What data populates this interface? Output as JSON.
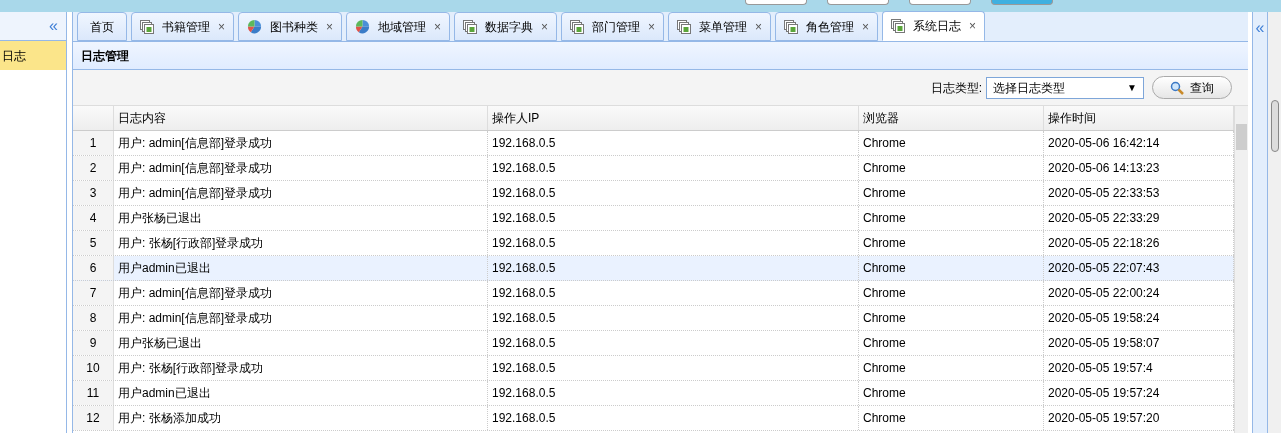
{
  "sidebar": {
    "items": [
      {
        "label": "日志",
        "selected": true
      }
    ]
  },
  "tabs": [
    {
      "label": "首页",
      "kind": "home",
      "selected": false
    },
    {
      "label": "书籍管理",
      "kind": "pages",
      "selected": false
    },
    {
      "label": "图书种类",
      "kind": "pie",
      "selected": false
    },
    {
      "label": "地域管理",
      "kind": "pie",
      "selected": false
    },
    {
      "label": "数据字典",
      "kind": "pages",
      "selected": false
    },
    {
      "label": "部门管理",
      "kind": "pages",
      "selected": false
    },
    {
      "label": "菜单管理",
      "kind": "pages",
      "selected": false
    },
    {
      "label": "角色管理",
      "kind": "pages",
      "selected": false
    },
    {
      "label": "系统日志",
      "kind": "pages",
      "selected": true
    }
  ],
  "close_glyph": "×",
  "collapse_glyph": "«",
  "panel": {
    "title": "日志管理"
  },
  "filter": {
    "label": "日志类型:",
    "value": "选择日志类型",
    "arrow": "▼",
    "button": "查询"
  },
  "table": {
    "columns": [
      "日志内容",
      "操作人IP",
      "浏览器",
      "操作时间"
    ],
    "rows": [
      {
        "index": "1",
        "content": "用户: admin[信息部]登录成功",
        "ip": "192.168.0.5",
        "browser": "Chrome",
        "time": "2020-05-06 16:42:14",
        "selected": false
      },
      {
        "index": "2",
        "content": "用户: admin[信息部]登录成功",
        "ip": "192.168.0.5",
        "browser": "Chrome",
        "time": "2020-05-06 14:13:23",
        "selected": false
      },
      {
        "index": "3",
        "content": "用户: admin[信息部]登录成功",
        "ip": "192.168.0.5",
        "browser": "Chrome",
        "time": "2020-05-05 22:33:53",
        "selected": false
      },
      {
        "index": "4",
        "content": "用户张杨已退出",
        "ip": "192.168.0.5",
        "browser": "Chrome",
        "time": "2020-05-05 22:33:29",
        "selected": false
      },
      {
        "index": "5",
        "content": "用户: 张杨[行政部]登录成功",
        "ip": "192.168.0.5",
        "browser": "Chrome",
        "time": "2020-05-05 22:18:26",
        "selected": false
      },
      {
        "index": "6",
        "content": "用户admin已退出",
        "ip": "192.168.0.5",
        "browser": "Chrome",
        "time": "2020-05-05 22:07:43",
        "selected": true
      },
      {
        "index": "7",
        "content": "用户: admin[信息部]登录成功",
        "ip": "192.168.0.5",
        "browser": "Chrome",
        "time": "2020-05-05 22:00:24",
        "selected": false
      },
      {
        "index": "8",
        "content": "用户: admin[信息部]登录成功",
        "ip": "192.168.0.5",
        "browser": "Chrome",
        "time": "2020-05-05 19:58:24",
        "selected": false
      },
      {
        "index": "9",
        "content": "用户张杨已退出",
        "ip": "192.168.0.5",
        "browser": "Chrome",
        "time": "2020-05-05 19:58:07",
        "selected": false
      },
      {
        "index": "10",
        "content": "用户: 张杨[行政部]登录成功",
        "ip": "192.168.0.5",
        "browser": "Chrome",
        "time": "2020-05-05 19:57:4",
        "selected": false
      },
      {
        "index": "11",
        "content": "用户admin已退出",
        "ip": "192.168.0.5",
        "browser": "Chrome",
        "time": "2020-05-05 19:57:24",
        "selected": false
      },
      {
        "index": "12",
        "content": "用户: 张杨添加成功",
        "ip": "192.168.0.5",
        "browser": "Chrome",
        "time": "2020-05-05 19:57:20",
        "selected": false
      }
    ]
  }
}
